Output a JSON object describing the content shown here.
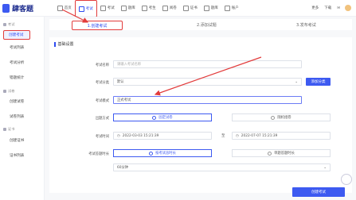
{
  "app": {
    "brand": "肆客题"
  },
  "nav": [
    {
      "label": "首页"
    },
    {
      "label": "考试"
    },
    {
      "label": "考试"
    },
    {
      "label": "题库"
    },
    {
      "label": "考生"
    },
    {
      "label": "阅卷"
    },
    {
      "label": "证书"
    },
    {
      "label": "题库"
    },
    {
      "label": "账户"
    }
  ],
  "tools": {
    "more": "更多",
    "download": "下载"
  },
  "sidebar": {
    "sections": [
      {
        "title": "考试",
        "items": [
          "创建考试",
          "考试列表",
          "考试分析",
          "错题统计"
        ]
      },
      {
        "title": "试卷",
        "items": [
          "创建试卷",
          "试卷列表"
        ]
      },
      {
        "title": "证书",
        "items": [
          "创建证书",
          "证书列表"
        ]
      }
    ]
  },
  "steps": [
    "1.创建考试",
    "2.添加试题",
    "3.发布考试"
  ],
  "form": {
    "section_title": "基础设置",
    "name_label": "考试名称",
    "name_placeholder": "请输入考试名称",
    "category_label": "考试分类",
    "category_value": "默认",
    "add_category": "添加分类",
    "mode_label": "考试模式",
    "mode_value": "正式考试",
    "grouping_label": "出题方式",
    "grouping_options": [
      "固定试卷",
      "随机组卷"
    ],
    "time_label": "考试时间",
    "start_time": "2022-03-03 15:21:39",
    "time_separator": "至",
    "end_time": "2022-07-07 15:21:39",
    "duration_label": "考试答题时长",
    "duration_options": [
      "按考试总时长",
      "单题答题时长"
    ],
    "duration_value": "60分钟"
  },
  "footer": {
    "create_button": "创建考试"
  },
  "accent": "#3d5af1",
  "highlight": "#e23b3b"
}
